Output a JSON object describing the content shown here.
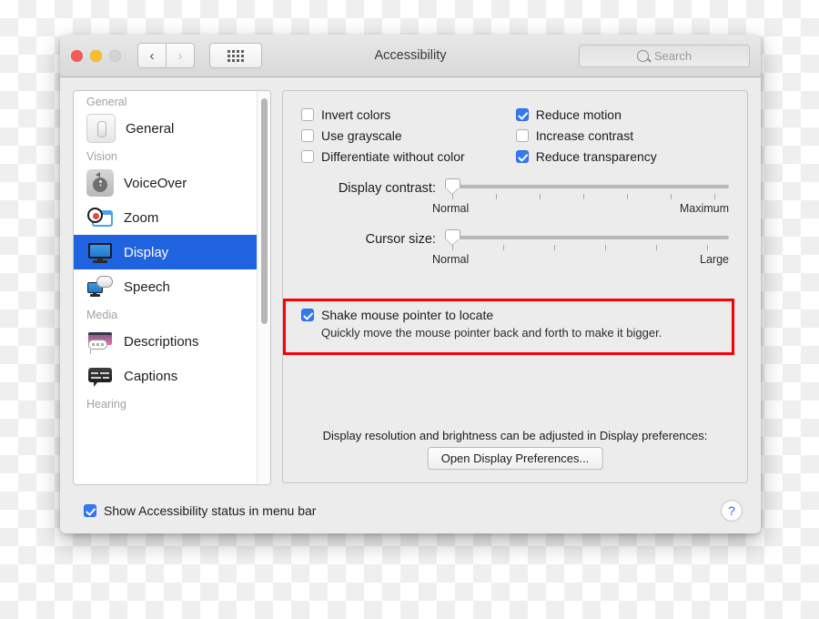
{
  "window": {
    "title": "Accessibility",
    "traffic_lights": [
      "close",
      "minimize",
      "zoom"
    ],
    "nav": {
      "back": "‹",
      "forward": "›"
    },
    "grid_button": "show-all-grid",
    "search": {
      "placeholder": "Search",
      "value": ""
    }
  },
  "sidebar": {
    "groups": [
      {
        "header": "General"
      },
      {
        "header": "Vision"
      },
      {
        "header": "Media"
      },
      {
        "header": "Hearing"
      }
    ],
    "items": [
      {
        "label": "General",
        "icon": "general-switch-icon",
        "selected": false
      },
      {
        "label": "VoiceOver",
        "icon": "voiceover-icon",
        "selected": false
      },
      {
        "label": "Zoom",
        "icon": "zoom-magnifier-icon",
        "selected": false
      },
      {
        "label": "Display",
        "icon": "display-monitor-icon",
        "selected": true
      },
      {
        "label": "Speech",
        "icon": "speech-bubble-icon",
        "selected": false
      },
      {
        "label": "Descriptions",
        "icon": "descriptions-icon",
        "selected": false
      },
      {
        "label": "Captions",
        "icon": "captions-icon",
        "selected": false
      }
    ]
  },
  "pane": {
    "checkboxes_left": [
      {
        "label": "Invert colors",
        "checked": false
      },
      {
        "label": "Use grayscale",
        "checked": false
      },
      {
        "label": "Differentiate without color",
        "checked": false
      }
    ],
    "checkboxes_right": [
      {
        "label": "Reduce motion",
        "checked": true
      },
      {
        "label": "Increase contrast",
        "checked": false
      },
      {
        "label": "Reduce transparency",
        "checked": true
      }
    ],
    "sliders": [
      {
        "label": "Display contrast:",
        "min_label": "Normal",
        "max_label": "Maximum",
        "value": 0,
        "ticks": 7
      },
      {
        "label": "Cursor size:",
        "min_label": "Normal",
        "max_label": "Large",
        "value": 0,
        "ticks": 6
      }
    ],
    "shake": {
      "label": "Shake mouse pointer to locate",
      "checked": true,
      "description": "Quickly move the mouse pointer back and forth to make it bigger.",
      "highlight_color": "#fb0007"
    },
    "bottom_note": "Display resolution and brightness can be adjusted in Display preferences:",
    "open_button": "Open Display Preferences..."
  },
  "footer": {
    "status_label": "Show Accessibility status in menu bar",
    "status_checked": true,
    "help": "?"
  },
  "colors": {
    "accent_blue": "#3478f6",
    "selection_blue": "#1f63e0",
    "highlight_red": "#fb0007"
  }
}
